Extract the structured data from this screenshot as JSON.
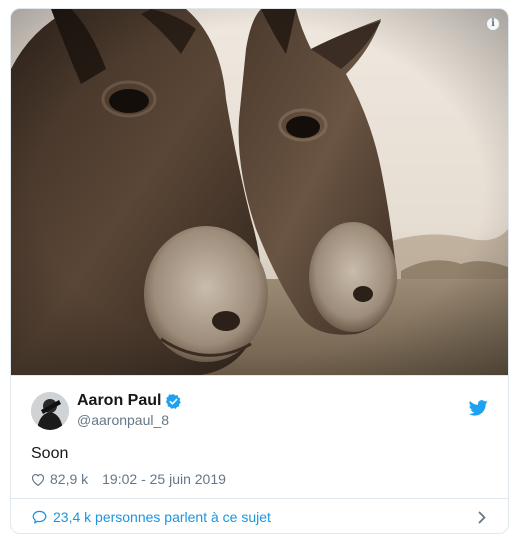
{
  "media": {
    "image_icon": "donkeys-photo",
    "info_icon": "info-icon",
    "info_glyph": "i"
  },
  "author": {
    "name": "Aaron Paul",
    "handle": "@aaronpaul_8",
    "verified_icon": "verified-badge-icon",
    "avatar_icon": "avatar"
  },
  "platform_icon": "twitter-bird-icon",
  "tweet": {
    "text": "Soon",
    "likes": "82,9 k",
    "timestamp": "19:02 - 25 juin 2019"
  },
  "footer": {
    "conversation_text": "23,4 k personnes parlent à ce sujet"
  },
  "colors": {
    "accent": "#1da1f2",
    "link": "#1b95e0",
    "muted": "#657786",
    "border": "#e1e8ed"
  }
}
